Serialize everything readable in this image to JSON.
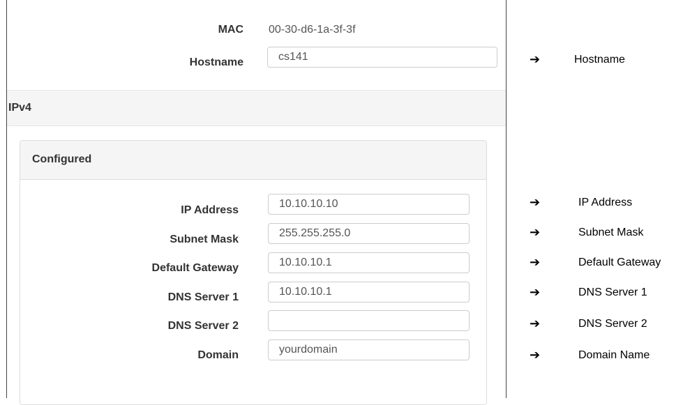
{
  "top": {
    "mac": {
      "label": "MAC",
      "value": "00-30-d6-1a-3f-3f"
    },
    "hostname": {
      "label": "Hostname",
      "value": "cs141"
    }
  },
  "ipv4": {
    "section_title": "IPv4",
    "panel_title": "Configured",
    "fields": [
      {
        "label": "IP Address",
        "value": "10.10.10.10"
      },
      {
        "label": "Subnet Mask",
        "value": "255.255.255.0"
      },
      {
        "label": "Default Gateway",
        "value": "10.10.10.1"
      },
      {
        "label": "DNS Server 1",
        "value": "10.10.10.1"
      },
      {
        "label": "DNS Server 2",
        "value": ""
      },
      {
        "label": "Domain",
        "value": "yourdomain"
      }
    ]
  },
  "annotations": {
    "arrow_glyph": "➔",
    "items": [
      "Hostname",
      "IP Address",
      "Subnet Mask",
      "Default Gateway",
      "DNS Server 1",
      "DNS Server 2",
      "Domain Name"
    ]
  }
}
